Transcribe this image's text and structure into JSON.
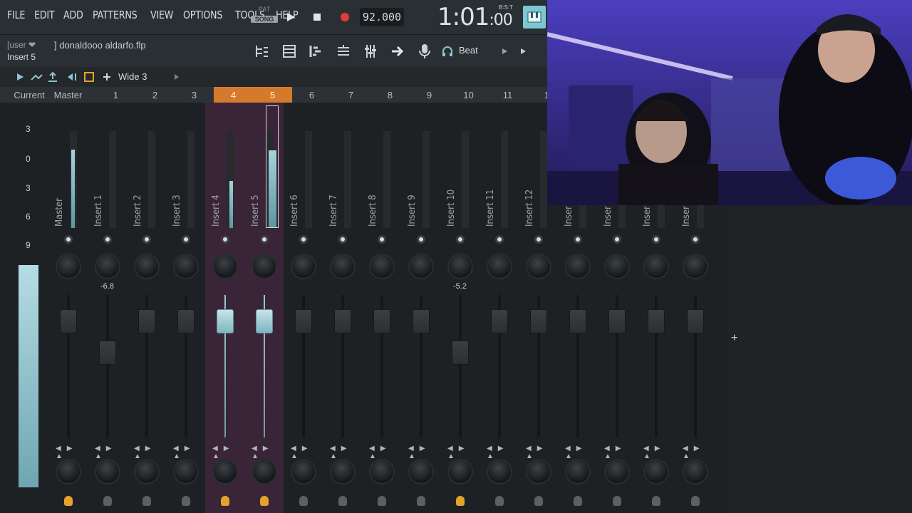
{
  "menu": [
    "FILE",
    "EDIT",
    "ADD",
    "PATTERNS",
    "VIEW",
    "OPTIONS",
    "TOOLS",
    "HELP"
  ],
  "pat_song": {
    "pat": "PAT",
    "song": "SONG"
  },
  "tempo": "92.000",
  "time": {
    "main": "1:01",
    "small": ":00",
    "label": "B:S:T"
  },
  "hint": {
    "user": "[user ❤",
    "insert": "Insert 5"
  },
  "filename": "] donaldooo aldarfo.flp",
  "beat_label": "Beat",
  "mixer_preset": "Wide 3",
  "header_labels": {
    "current": "Current",
    "master": "Master"
  },
  "track_numbers": [
    "1",
    "2",
    "3",
    "4",
    "5",
    "6",
    "7",
    "8",
    "9",
    "10",
    "11",
    "1"
  ],
  "scale": [
    "3",
    "0",
    "3",
    "6",
    "9"
  ],
  "strips": [
    {
      "name": "Master",
      "sel": false,
      "lamp": true,
      "fader_pos": 0.0,
      "db": ""
    },
    {
      "name": "Insert 1",
      "sel": false,
      "lamp": false,
      "fader_pos": 0.2,
      "db": "-6.8"
    },
    {
      "name": "Insert 2",
      "sel": false,
      "lamp": false,
      "fader_pos": 0.0,
      "db": ""
    },
    {
      "name": "Insert 3",
      "sel": false,
      "lamp": false,
      "fader_pos": 0.0,
      "db": ""
    },
    {
      "name": "Insert 4",
      "sel": true,
      "lamp": true,
      "fader_pos": 0.0,
      "db": "",
      "lit": true
    },
    {
      "name": "Insert 5",
      "sel": true,
      "lamp": true,
      "fader_pos": 0.0,
      "db": "",
      "lit": true
    },
    {
      "name": "Insert 6",
      "sel": false,
      "lamp": false,
      "fader_pos": 0.0,
      "db": ""
    },
    {
      "name": "Insert 7",
      "sel": false,
      "lamp": false,
      "fader_pos": 0.0,
      "db": ""
    },
    {
      "name": "Insert 8",
      "sel": false,
      "lamp": false,
      "fader_pos": 0.0,
      "db": ""
    },
    {
      "name": "Insert 9",
      "sel": false,
      "lamp": false,
      "fader_pos": 0.0,
      "db": ""
    },
    {
      "name": "Insert 10",
      "sel": false,
      "lamp": true,
      "fader_pos": 0.2,
      "db": "-5.2"
    },
    {
      "name": "Insert 11",
      "sel": false,
      "lamp": false,
      "fader_pos": 0.0,
      "db": ""
    },
    {
      "name": "Insert 12",
      "sel": false,
      "lamp": false,
      "fader_pos": 0.0,
      "db": ""
    },
    {
      "name": "Inser",
      "sel": false,
      "lamp": false,
      "fader_pos": 0.0,
      "db": ""
    },
    {
      "name": "Inser",
      "sel": false,
      "lamp": false,
      "fader_pos": 0.0,
      "db": ""
    },
    {
      "name": "Inser",
      "sel": false,
      "lamp": false,
      "fader_pos": 0.0,
      "db": ""
    },
    {
      "name": "Inser",
      "sel": false,
      "lamp": false,
      "fader_pos": 0.0,
      "db": ""
    }
  ],
  "colors": {
    "accent": "#d57a2d",
    "meter": "#8cc4ce",
    "selected_strip": "#3a2437",
    "lamp_on": "#e6a32c"
  }
}
